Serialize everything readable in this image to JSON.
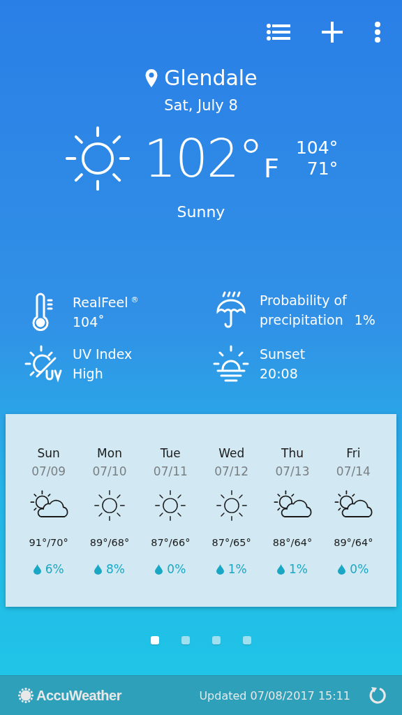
{
  "location": {
    "city": "Glendale",
    "date": "Sat, July 8"
  },
  "current": {
    "temperature": "102°",
    "unit": "F",
    "high": "104°",
    "low": "71°",
    "condition": "Sunny",
    "kind": "sunny"
  },
  "details": [
    {
      "kind": "realfeel",
      "label": "RealFeel",
      "label_mark": "®",
      "value": "104˚"
    },
    {
      "kind": "precipitation",
      "label": "Probability of precipitation",
      "value": "1%"
    },
    {
      "kind": "uv",
      "label": "UV Index",
      "value": "High"
    },
    {
      "kind": "sunset",
      "label": "Sunset",
      "value": "20:08"
    }
  ],
  "forecast": [
    {
      "day": "Sun",
      "date": "07/09",
      "kind": "partly_sunny",
      "temps": "91°/70°",
      "precip": "6%"
    },
    {
      "day": "Mon",
      "date": "07/10",
      "kind": "sunny",
      "temps": "89°/68°",
      "precip": "8%"
    },
    {
      "day": "Tue",
      "date": "07/11",
      "kind": "sunny",
      "temps": "87°/66°",
      "precip": "0%"
    },
    {
      "day": "Wed",
      "date": "07/12",
      "kind": "sunny",
      "temps": "87°/65°",
      "precip": "1%"
    },
    {
      "day": "Thu",
      "date": "07/13",
      "kind": "partly_sunny",
      "temps": "88°/64°",
      "precip": "1%"
    },
    {
      "day": "Fri",
      "date": "07/14",
      "kind": "partly_sunny",
      "temps": "89°/64°",
      "precip": "0%"
    }
  ],
  "pages": [
    {
      "selected": true
    },
    {
      "selected": false
    },
    {
      "selected": false
    },
    {
      "selected": false
    }
  ],
  "footer": {
    "brand": "AccuWeather",
    "updated": "Updated 07/08/2017 15:11"
  }
}
